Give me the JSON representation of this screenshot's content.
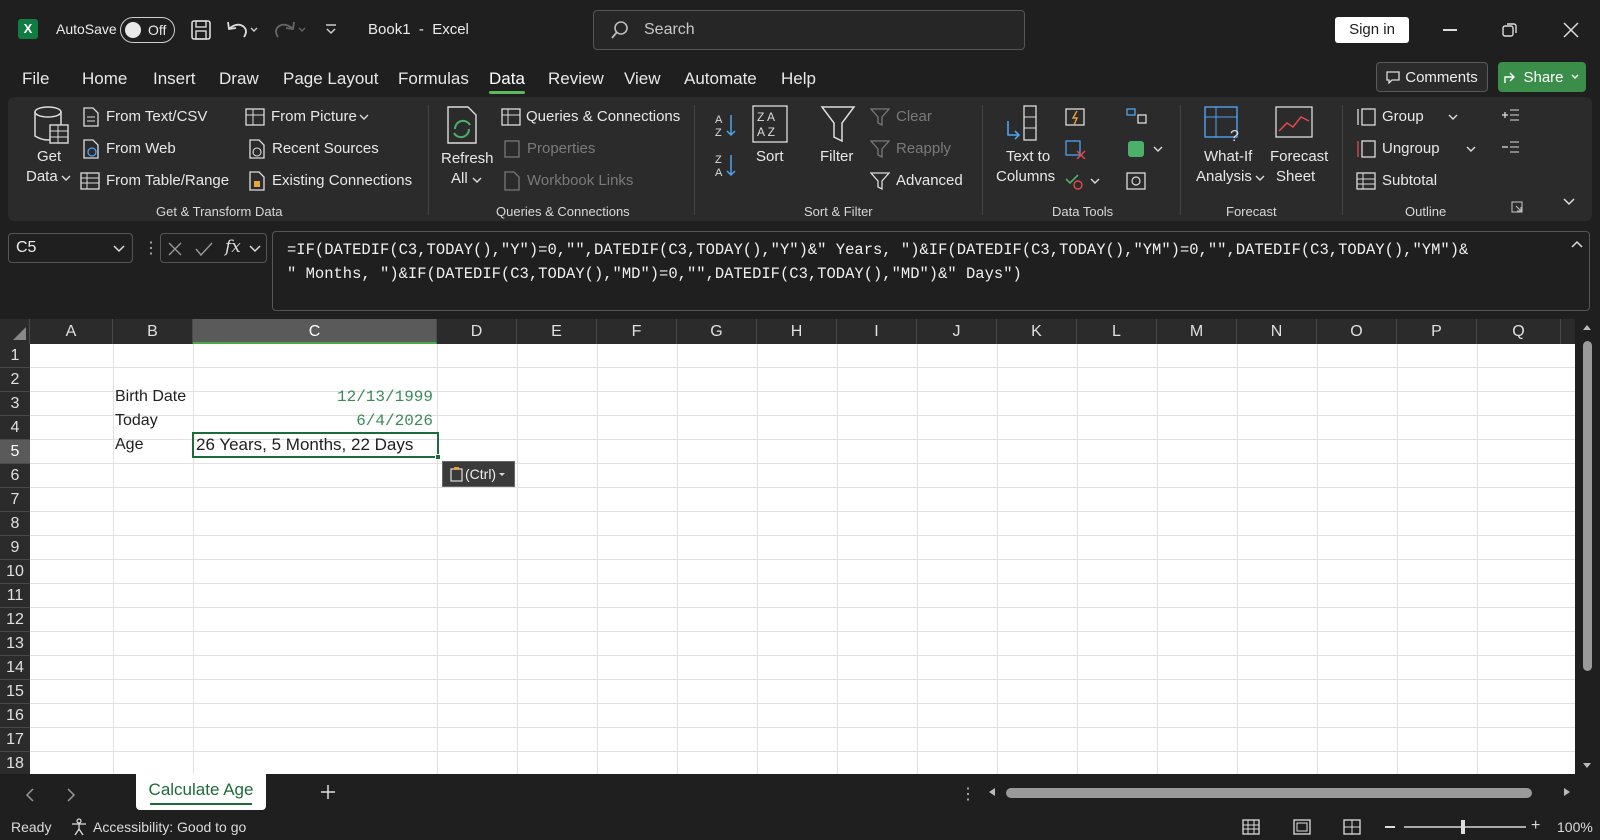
{
  "titlebar": {
    "autosave_label": "AutoSave",
    "autosave_state": "Off",
    "doc_title": "Book1  -  Excel",
    "search_placeholder": "Search",
    "signin_label": "Sign in"
  },
  "tabs": [
    "File",
    "Home",
    "Insert",
    "Draw",
    "Page Layout",
    "Formulas",
    "Data",
    "Review",
    "View",
    "Automate",
    "Help"
  ],
  "active_tab": "Data",
  "actions": {
    "comments": "Comments",
    "share": "Share"
  },
  "ribbon": {
    "get_data": {
      "line1": "Get",
      "line2": "Data"
    },
    "from_text_csv": "From Text/CSV",
    "from_web": "From Web",
    "from_table_range": "From Table/Range",
    "from_picture": "From Picture",
    "recent_sources": "Recent Sources",
    "existing_connections": "Existing Connections",
    "group_get_transform": "Get & Transform Data",
    "refresh_all": {
      "line1": "Refresh",
      "line2": "All"
    },
    "queries_connections": "Queries & Connections",
    "properties": "Properties",
    "workbook_links": "Workbook Links",
    "group_queries": "Queries & Connections",
    "sort": "Sort",
    "filter": "Filter",
    "clear": "Clear",
    "reapply": "Reapply",
    "advanced": "Advanced",
    "group_sort_filter": "Sort & Filter",
    "text_to_columns": {
      "line1": "Text to",
      "line2": "Columns"
    },
    "group_data_tools": "Data Tools",
    "what_if": {
      "line1": "What-If",
      "line2": "Analysis"
    },
    "forecast_sheet": {
      "line1": "Forecast",
      "line2": "Sheet"
    },
    "group_forecast": "Forecast",
    "group": "Group",
    "ungroup": "Ungroup",
    "subtotal": "Subtotal",
    "group_outline": "Outline"
  },
  "formula_bar": {
    "name_box": "C5",
    "fx": "fx",
    "formula_line1": "=IF(DATEDIF(C3,TODAY(),\"Y\")=0,\"\",DATEDIF(C3,TODAY(),\"Y\")&\" Years, \")&IF(DATEDIF(C3,TODAY(),\"YM\")=0,\"\",DATEDIF(C3,TODAY(),\"YM\")&",
    "formula_line2": "\" Months, \")&IF(DATEDIF(C3,TODAY(),\"MD\")=0,\"\",DATEDIF(C3,TODAY(),\"MD\")&\" Days\")"
  },
  "columns": [
    "A",
    "B",
    "C",
    "D",
    "E",
    "F",
    "G",
    "H",
    "I",
    "J",
    "K",
    "L",
    "M",
    "N",
    "O",
    "P",
    "Q"
  ],
  "rows": [
    "1",
    "2",
    "3",
    "4",
    "5",
    "6",
    "7",
    "8",
    "9",
    "10",
    "11",
    "12",
    "13",
    "14",
    "15",
    "16",
    "17",
    "18"
  ],
  "cells": {
    "B3": "Birth Date",
    "C3": "12/13/1999",
    "B4": "Today",
    "C4": "6/4/2026",
    "B5": "Age",
    "C5": "26 Years, 5 Months, 22 Days"
  },
  "paste_options": "(Ctrl)",
  "sheet_tab": "Calculate Age",
  "status": {
    "ready": "Ready",
    "accessibility": "Accessibility: Good to go",
    "zoom": "100%"
  },
  "colors": {
    "accent": "#5cb85c",
    "date_text": "#3c8a5a"
  }
}
